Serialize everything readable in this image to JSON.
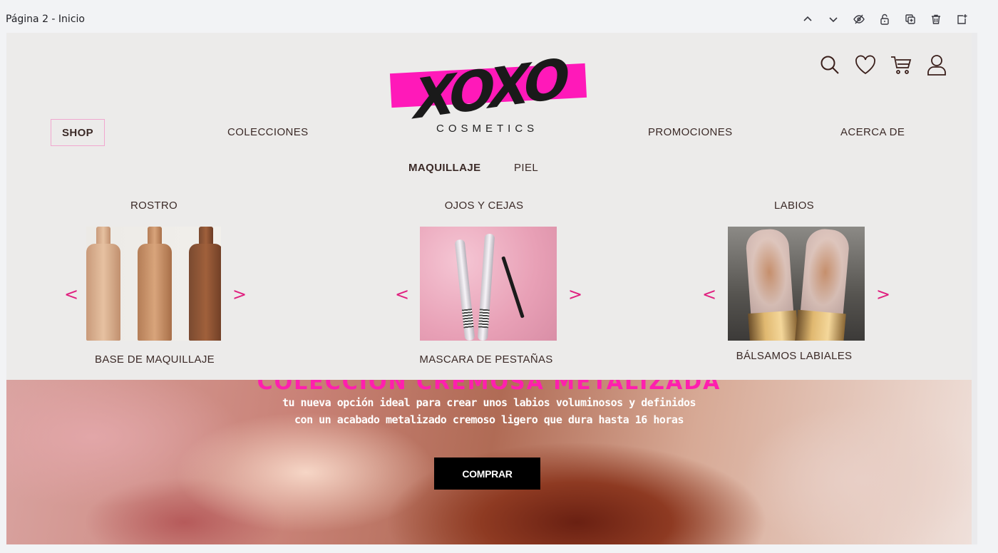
{
  "editor": {
    "page_label": "Página 2 - Inicio",
    "tools": [
      "chevron-up-icon",
      "chevron-down-icon",
      "eye-hide-icon",
      "lock-icon",
      "duplicate-icon",
      "trash-icon",
      "add-page-icon"
    ]
  },
  "brand": {
    "logo_word": "XOXO",
    "logo_sub": "COSMETICS",
    "accent": "#ff19b9"
  },
  "header_icons": [
    "search-icon",
    "heart-icon",
    "cart-icon",
    "user-icon"
  ],
  "nav": {
    "shop": "SHOP",
    "collections": "COLECCIONES",
    "promotions": "PROMOCIONES",
    "about": "ACERCA DE"
  },
  "subtabs": {
    "makeup": "MAQUILLAJE",
    "skin": "PIEL"
  },
  "categories": [
    {
      "title": "ROSTRO",
      "item": "BASE DE MAQUILLAJE"
    },
    {
      "title": "OJOS Y CEJAS",
      "item": "MASCARA DE PESTAÑAS"
    },
    {
      "title": "LABIOS",
      "item": "BÁLSAMOS LABIALES"
    }
  ],
  "arrows": {
    "prev": "<",
    "next": ">"
  },
  "hero": {
    "title": "COLECCIÓN CREMOSA METALIZADA",
    "line1": "tu nueva opción ideal para crear unos labios voluminosos y definidos",
    "line2": "con un acabado metalizado cremoso ligero que dura hasta 16 horas",
    "button": "COMPRAR"
  }
}
